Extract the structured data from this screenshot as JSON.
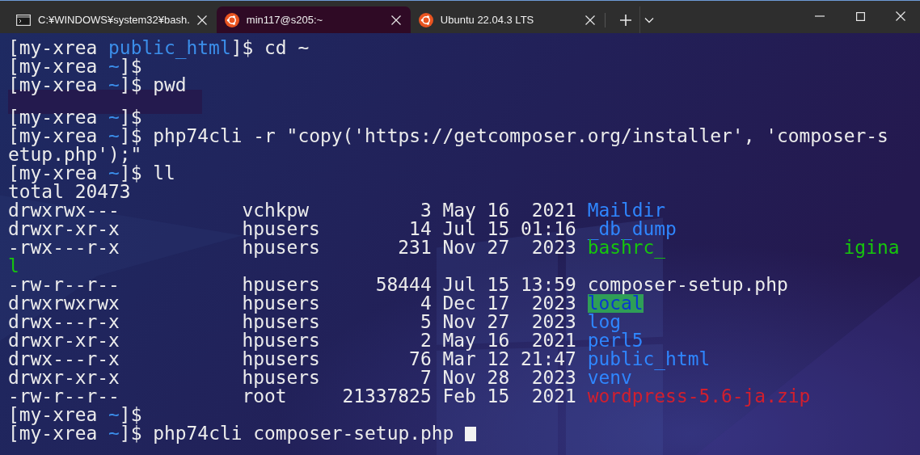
{
  "window": {
    "tabs": [
      {
        "title": "C:¥WINDOWS¥system32¥bash.",
        "kind": "console",
        "selected": false
      },
      {
        "title": "min117@s205:~",
        "kind": "linux",
        "selected": true
      },
      {
        "title": "Ubuntu 22.04.3 LTS",
        "kind": "linux",
        "selected": false
      }
    ]
  },
  "terminal": {
    "lines": [
      {
        "kind": "prompt",
        "user": "[my-xrea",
        "path": "public_html",
        "end": "]$",
        "command": "cd ~"
      },
      {
        "kind": "prompt",
        "user": "[my-xrea",
        "path": "~",
        "end": "]$"
      },
      {
        "kind": "prompt",
        "user": "[my-xrea",
        "path": "~",
        "end": "]$",
        "command": "pwd"
      },
      {
        "kind": "redacted"
      },
      {
        "kind": "prompt",
        "user": "[my-xrea",
        "path": "~",
        "end": "]$"
      },
      {
        "kind": "prompt",
        "user": "[my-xrea",
        "path": "~",
        "end": "]$",
        "command": "php74cli -r \"copy('https://getcomposer.org/installer', 'composer-s"
      },
      {
        "kind": "output",
        "text": "etup.php');\""
      },
      {
        "kind": "prompt",
        "user": "[my-xrea",
        "path": "~",
        "end": "]$",
        "command": "ll"
      },
      {
        "kind": "output",
        "text": "total 20473"
      },
      {
        "kind": "entry",
        "perms": "drwxrwx---",
        "owner": "vchkpw",
        "size": "3",
        "date": "May 16  2021",
        "name": "Maildir",
        "color": "#2f86ff"
      },
      {
        "kind": "entry",
        "perms": "drwxr-xr-x",
        "owner": "hpusers",
        "size": "14",
        "date": "Jul 15 01:16",
        "name": "_db_dump",
        "color": "#2f86ff"
      },
      {
        "kind": "entry",
        "perms": "-rwx---r-x",
        "owner": "hpusers",
        "size": "231",
        "date": "Nov 27  2023",
        "name": "bashrc_",
        "name_end": "igina",
        "color": "#16c60c"
      },
      {
        "kind": "output",
        "text": "l",
        "color": "#16c60c"
      },
      {
        "kind": "entry",
        "perms": "-rw-r--r--",
        "owner": "hpusers",
        "size": "58444",
        "date": "Jul 15 13:59",
        "name": "composer-setup.php",
        "color": "#ececec"
      },
      {
        "kind": "entry",
        "perms": "drwxrwxrwx",
        "owner": "hpusers",
        "size": "4",
        "date": "Dec 17  2023",
        "name": "local",
        "highlighted": true
      },
      {
        "kind": "entry",
        "perms": "drwx---r-x",
        "owner": "hpusers",
        "size": "5",
        "date": "Nov 27  2023",
        "name": "log",
        "color": "#2f86ff"
      },
      {
        "kind": "entry",
        "perms": "drwxr-xr-x",
        "owner": "hpusers",
        "size": "2",
        "date": "May 16  2021",
        "name": "perl5",
        "color": "#2f86ff"
      },
      {
        "kind": "entry",
        "perms": "drwx---r-x",
        "owner": "hpusers",
        "size": "76",
        "date": "Mar 12 21:47",
        "name": "public_html",
        "color": "#2f86ff"
      },
      {
        "kind": "entry",
        "perms": "drwxr-xr-x",
        "owner": "hpusers",
        "size": "7",
        "date": "Nov 28  2023",
        "name": "venv",
        "color": "#2f86ff"
      },
      {
        "kind": "entry",
        "perms": "-rw-r--r--",
        "owner": "root",
        "size": "21337825",
        "date": "Feb 15  2021",
        "name": "wordpress-5.6-ja.zip",
        "color": "#d21f2e"
      },
      {
        "kind": "prompt",
        "user": "[my-xrea",
        "path": "~",
        "end": "]$"
      },
      {
        "kind": "prompt",
        "user": "[my-xrea",
        "path": "~",
        "end": "]$",
        "command": "php74cli composer-setup.php",
        "cursor": true
      }
    ]
  }
}
